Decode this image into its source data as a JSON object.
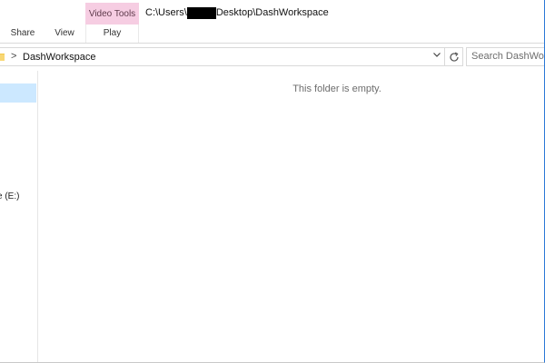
{
  "titlebar": {
    "context_tab_header": "Video Tools",
    "path_prefix": "C:\\Users\\",
    "path_suffix": "Desktop\\DashWorkspace"
  },
  "ribbon": {
    "tabs": [
      {
        "label": "Share"
      },
      {
        "label": "View"
      },
      {
        "label": "Play"
      }
    ]
  },
  "address_bar": {
    "breadcrumb_separator": ">",
    "current_folder": "DashWorkspace",
    "dropdown_icon": "chevron-down-icon",
    "refresh_icon": "refresh-icon"
  },
  "search": {
    "placeholder": "Search DashWorkspace"
  },
  "navigation_pane": {
    "drive_label": "e (E:)"
  },
  "content": {
    "empty_message": "This folder is empty."
  },
  "colors": {
    "context_tab": "#f6cde2",
    "selection": "#cce8ff",
    "window_border": "#2b79d7"
  }
}
